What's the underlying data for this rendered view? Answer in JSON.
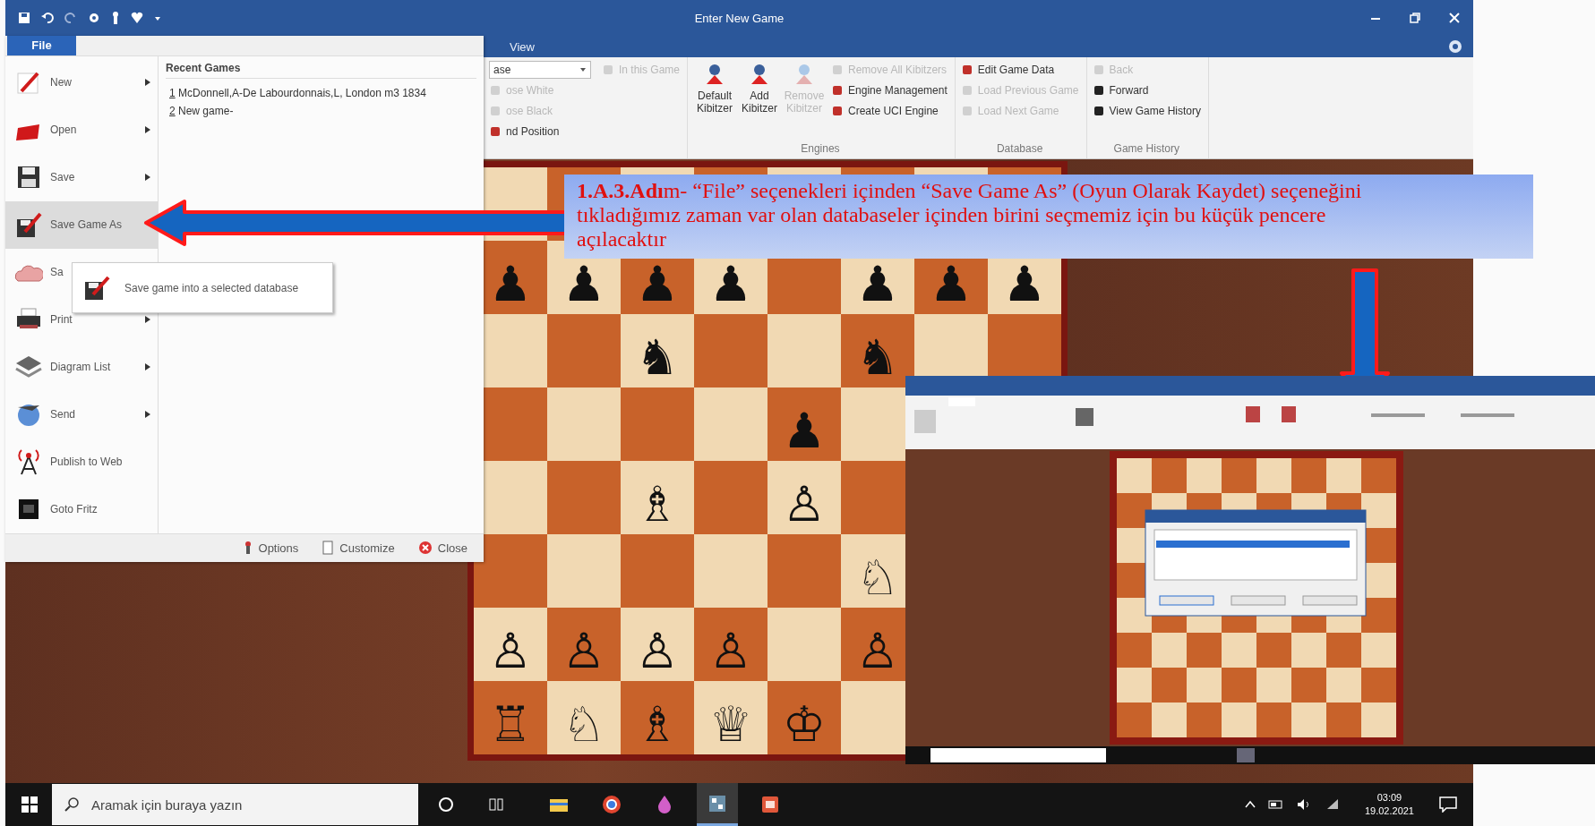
{
  "window": {
    "title": "Enter New Game"
  },
  "ribbon_tabs": [
    {
      "label": "View",
      "selected": false
    }
  ],
  "ribbon": {
    "groups": [
      {
        "combo": "ase",
        "items": [
          {
            "label": "In this Game",
            "disabled": true
          },
          {
            "label": "ose White",
            "disabled": true
          },
          {
            "label": "ose Black",
            "disabled": true
          },
          {
            "label": "nd Position",
            "disabled": false
          }
        ]
      },
      {
        "label": "Engines",
        "big_buttons": [
          {
            "label": "Default Kibitzer",
            "disabled": false
          },
          {
            "label": "Add Kibitzer",
            "disabled": false
          },
          {
            "label": "Remove Kibitzer",
            "disabled": true
          }
        ],
        "items": [
          {
            "label": "Remove All Kibitzers",
            "disabled": true
          },
          {
            "label": "Engine Management",
            "disabled": false
          },
          {
            "label": "Create UCI Engine",
            "disabled": false
          }
        ]
      },
      {
        "label": "Database",
        "items": [
          {
            "label": "Edit Game Data",
            "disabled": false
          },
          {
            "label": "Load Previous Game",
            "disabled": true
          },
          {
            "label": "Load Next Game",
            "disabled": true
          }
        ]
      },
      {
        "label": "Game History",
        "items": [
          {
            "label": "Back",
            "disabled": true
          },
          {
            "label": "Forward",
            "disabled": false
          },
          {
            "label": "View Game History",
            "disabled": false
          }
        ]
      }
    ]
  },
  "file_menu": {
    "tab": {
      "label": "File",
      "selected": true
    },
    "items": [
      {
        "label": "New",
        "submenu": true,
        "selected": false
      },
      {
        "label": "Open",
        "submenu": true,
        "selected": false
      },
      {
        "label": "Save",
        "submenu": true,
        "selected": false
      },
      {
        "label": "Save Game As",
        "submenu": false,
        "selected": true
      },
      {
        "label": "Sa",
        "submenu": false,
        "selected": false
      },
      {
        "label": "Print",
        "submenu": true,
        "selected": false
      },
      {
        "label": "Diagram List",
        "submenu": true,
        "selected": false
      },
      {
        "label": "Send",
        "submenu": true,
        "selected": false
      },
      {
        "label": "Publish to Web",
        "submenu": false,
        "selected": false
      },
      {
        "label": "Goto Fritz",
        "submenu": false,
        "selected": false
      }
    ],
    "recent_games": {
      "title": "Recent Games",
      "items": [
        {
          "number": "1",
          "label": "McDonnell,A-De Labourdonnais,L, London m3 1834"
        },
        {
          "number": "2",
          "label": "New game-"
        }
      ]
    },
    "footer": [
      {
        "label": "Options"
      },
      {
        "label": "Customize"
      },
      {
        "label": "Close"
      }
    ]
  },
  "tooltip": {
    "text": "Save game into a selected database"
  },
  "board": {
    "ranks": [
      {
        "cells": [
          {},
          {},
          {},
          {},
          {},
          {},
          {},
          {}
        ]
      },
      {
        "cells": [
          {
            "piece": "♟"
          },
          {
            "piece": "♟"
          },
          {
            "piece": "♟"
          },
          {
            "piece": "♟"
          },
          {},
          {
            "piece": "♟"
          },
          {
            "piece": "♟"
          },
          {
            "piece": "♟"
          }
        ]
      },
      {
        "cells": [
          {},
          {},
          {
            "piece": "♞"
          },
          {},
          {},
          {
            "piece": "♞"
          },
          {},
          {}
        ]
      },
      {
        "cells": [
          {},
          {},
          {},
          {},
          {
            "piece": "♟"
          },
          {},
          {},
          {}
        ]
      },
      {
        "cells": [
          {},
          {},
          {
            "piece": "♗"
          },
          {},
          {
            "piece": "♙"
          },
          {},
          {},
          {}
        ]
      },
      {
        "cells": [
          {},
          {},
          {},
          {},
          {},
          {
            "piece": "♘"
          },
          {},
          {}
        ]
      },
      {
        "cells": [
          {
            "piece": "♙"
          },
          {
            "piece": "♙"
          },
          {
            "piece": "♙"
          },
          {
            "piece": "♙"
          },
          {},
          {
            "piece": "♙"
          },
          {},
          {}
        ]
      },
      {
        "cells": [
          {
            "piece": "♖"
          },
          {
            "piece": "♘"
          },
          {
            "piece": "♗"
          },
          {
            "piece": "♕"
          },
          {
            "piece": "♔"
          },
          {},
          {},
          {}
        ]
      }
    ]
  },
  "annotation": {
    "text": "**1.A.3.Adı**m- “File” seçenekleri içinden “Save Game As” (Oyun Olarak Kaydet) seçeneğini tıkladığımız zaman var olan databaseler içinden birini seçmemiz için bu küçük pencere açılacaktır"
  },
  "taskbar": {
    "search": {
      "placeholder": "Aramak için buraya yazın"
    },
    "apps": [
      {
        "selected": false
      },
      {
        "selected": false
      },
      {
        "selected": false
      },
      {
        "selected": true
      },
      {
        "selected": false
      }
    ],
    "time": "03:09",
    "date": "19.02.2021"
  }
}
